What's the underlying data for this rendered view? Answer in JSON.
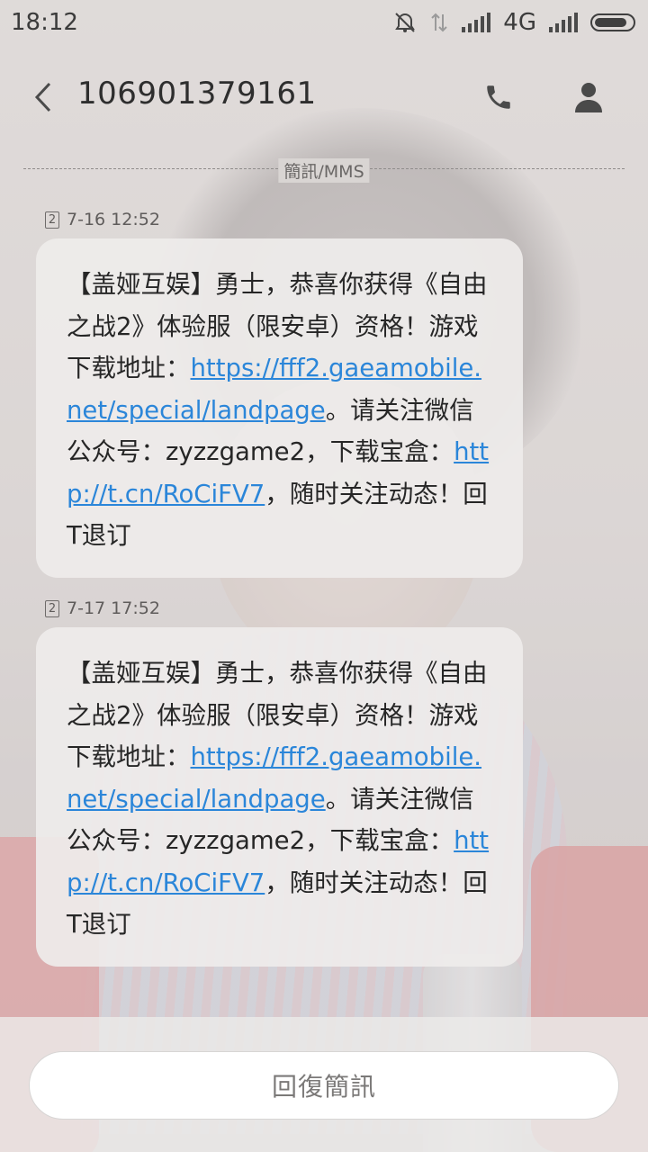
{
  "status_bar": {
    "time": "18:12",
    "network": "4G"
  },
  "header": {
    "title": "106901379161",
    "back_icon": "chevron-left-icon",
    "call_icon": "phone-icon",
    "contact_icon": "person-icon"
  },
  "divider": {
    "label": "簡訊/MMS"
  },
  "messages": [
    {
      "sim": "2",
      "time": "7-16 12:52",
      "text_1": "【盖娅互娱】勇士，恭喜你获得《自由之战2》体验服（限安卓）资格！游戏下载地址：",
      "link_1": "https://fff2.gaeamobile.net/special/landpage",
      "text_2": "。请关注微信公众号：zyzzgame2，下载宝盒：",
      "link_2": "http://t.cn/RoCiFV7",
      "text_3": "，随时关注动态！回T退订"
    },
    {
      "sim": "2",
      "time": "7-17 17:52",
      "text_1": "【盖娅互娱】勇士，恭喜你获得《自由之战2》体验服（限安卓）资格！游戏下载地址：",
      "link_1": "https://fff2.gaeamobile.net/special/landpage",
      "text_2": "。请关注微信公众号：zyzzgame2，下载宝盒：",
      "link_2": "http://t.cn/RoCiFV7",
      "text_3": "，随时关注动态！回T退订"
    }
  ],
  "reply": {
    "label": "回復簡訊"
  },
  "colors": {
    "link": "#2b86d9",
    "bubble_bg": "#eeeceb",
    "text": "#262626"
  }
}
